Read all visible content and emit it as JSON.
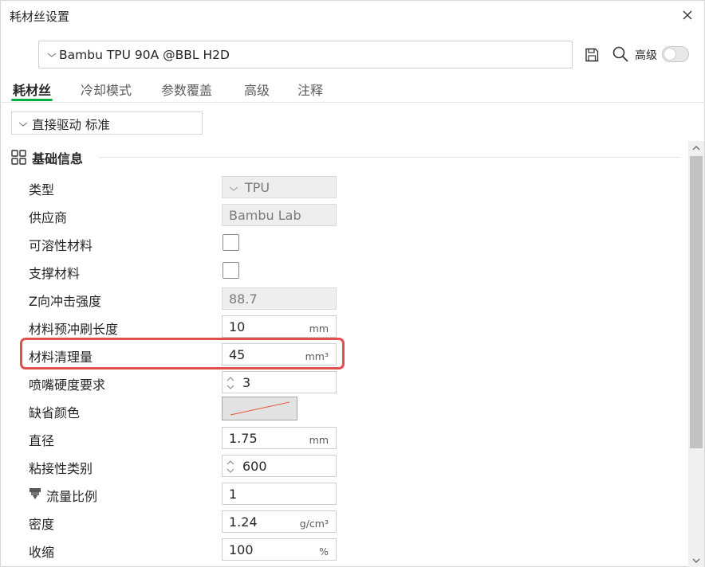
{
  "window": {
    "title": "耗材丝设置"
  },
  "preset": {
    "value": "Bambu TPU 90A @BBL H2D"
  },
  "toolbar": {
    "advanced_label": "高级",
    "advanced_enabled": false
  },
  "tabs": [
    {
      "label": "耗材丝",
      "active": true
    },
    {
      "label": "冷却模式",
      "active": false
    },
    {
      "label": "参数覆盖",
      "active": false
    },
    {
      "label": "高级",
      "active": false
    },
    {
      "label": "注释",
      "active": false
    }
  ],
  "extruder": {
    "value": "直接驱动 标准"
  },
  "section": {
    "title": "基础信息"
  },
  "fields": {
    "type": {
      "label": "类型",
      "value": "TPU"
    },
    "vendor": {
      "label": "供应商",
      "value": "Bambu Lab"
    },
    "soluble": {
      "label": "可溶性材料",
      "checked": false
    },
    "support": {
      "label": "支撑材料",
      "checked": false
    },
    "impact": {
      "label": "Z向冲击强度",
      "value": "88.7"
    },
    "prime_len": {
      "label": "材料预冲刷长度",
      "value": "10",
      "unit": "mm"
    },
    "purge_vol": {
      "label": "材料清理量",
      "value": "45",
      "unit": "mm³"
    },
    "nozzle_hrc": {
      "label": "喷嘴硬度要求",
      "value": "3"
    },
    "default_color": {
      "label": "缺省颜色"
    },
    "diameter": {
      "label": "直径",
      "value": "1.75",
      "unit": "mm"
    },
    "adhesion": {
      "label": "粘接性类别",
      "value": "600"
    },
    "flow_ratio": {
      "label": "流量比例",
      "value": "1"
    },
    "density": {
      "label": "密度",
      "value": "1.24",
      "unit": "g/cm³"
    },
    "shrinkage": {
      "label": "收缩",
      "value": "100",
      "unit": "%"
    }
  },
  "colors": {
    "accent": "#00ae42",
    "highlight": "#e0514d",
    "swatch_line": "#e8583c"
  },
  "icons": [
    "close-icon",
    "chevron-down-icon",
    "save-icon",
    "search-icon",
    "grid-icon",
    "spin-icon",
    "nozzle-flow-icon"
  ]
}
